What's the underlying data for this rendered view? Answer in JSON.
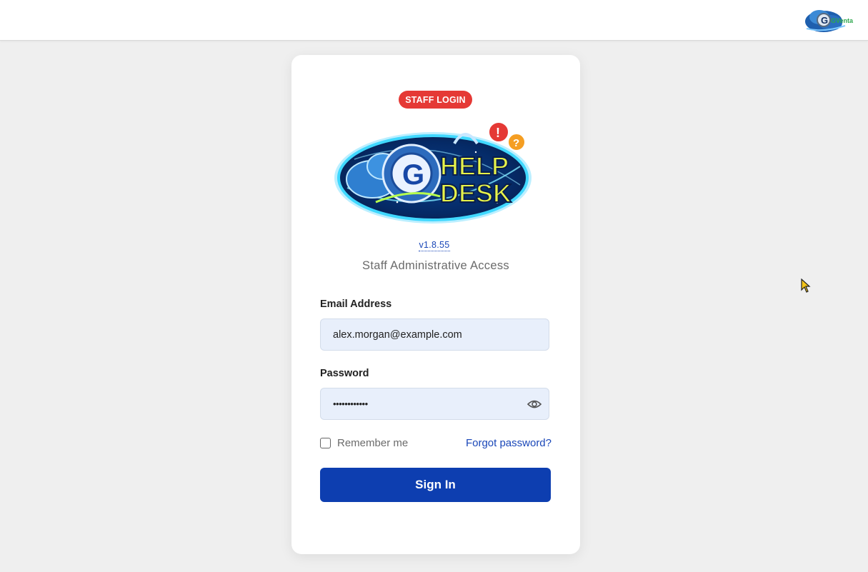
{
  "login": {
    "badge": "STAFF LOGIN",
    "version": "v1.8.55",
    "subtitle": "Staff Administrative Access",
    "email_label": "Email Address",
    "email_value": "alex.morgan@example.com",
    "password_label": "Password",
    "password_value": "••••••••••••",
    "remember_label": "Remember me",
    "forgot_label": "Forgot password?",
    "signin_label": "Sign In"
  },
  "logo": {
    "hero_text_line1": "HELP",
    "hero_text_line2": "DESK",
    "hero_letter": "G",
    "corner_text": "GVenta"
  },
  "icons": {
    "show_password": "eye-icon",
    "cursor": "mouse-pointer-icon"
  },
  "colors": {
    "badge_red": "#e53935",
    "primary_blue": "#0d3eb0",
    "link_blue": "#1a47b8",
    "input_bg": "#e8effb"
  }
}
